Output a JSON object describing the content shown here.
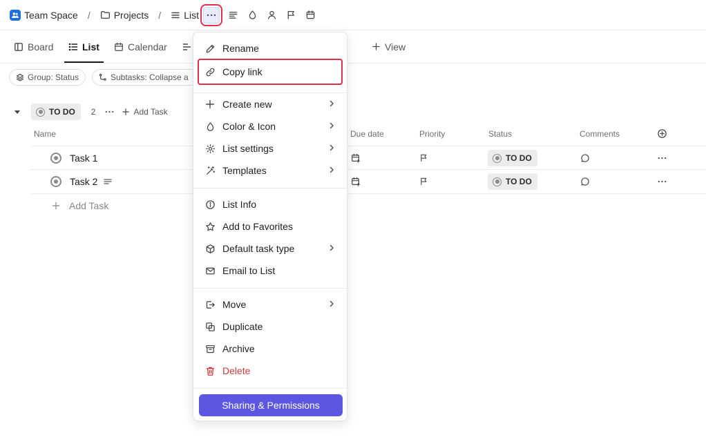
{
  "breadcrumb": {
    "space": "Team Space",
    "folder": "Projects",
    "list": "List",
    "separator": "/"
  },
  "tabs": [
    {
      "label": "Board",
      "icon": "board-icon"
    },
    {
      "label": "List",
      "icon": "list-icon",
      "active": true
    },
    {
      "label": "Calendar",
      "icon": "calendar-icon"
    },
    {
      "label": "",
      "icon": "gantt-icon"
    }
  ],
  "add_view_label": "View",
  "chips": {
    "group": "Group: Status",
    "subtasks": "Subtasks: Collapse a"
  },
  "group": {
    "status": "TO DO",
    "count": "2",
    "add_task": "Add Task"
  },
  "columns": {
    "name": "Name",
    "due_date": "Due date",
    "priority": "Priority",
    "status": "Status",
    "comments": "Comments"
  },
  "tasks": [
    {
      "name": "Task 1",
      "status": "TO DO",
      "has_description": false
    },
    {
      "name": "Task 2",
      "status": "TO DO",
      "has_description": true
    }
  ],
  "add_task_row": "Add Task",
  "menu": {
    "items": [
      {
        "label": "Rename",
        "icon": "pencil-icon"
      },
      {
        "label": "Copy link",
        "icon": "link-icon",
        "highlighted": true
      },
      {
        "label": "Create new",
        "icon": "plus-icon",
        "submenu": true
      },
      {
        "label": "Color & Icon",
        "icon": "droplet-icon",
        "submenu": true
      },
      {
        "label": "List settings",
        "icon": "gear-icon",
        "submenu": true
      },
      {
        "label": "Templates",
        "icon": "magic-wand-icon",
        "submenu": true
      },
      {
        "label": "List Info",
        "icon": "info-icon"
      },
      {
        "label": "Add to Favorites",
        "icon": "star-icon"
      },
      {
        "label": "Default task type",
        "icon": "cube-icon",
        "submenu": true
      },
      {
        "label": "Email to List",
        "icon": "mail-icon"
      },
      {
        "label": "Move",
        "icon": "move-icon",
        "submenu": true
      },
      {
        "label": "Duplicate",
        "icon": "duplicate-icon"
      },
      {
        "label": "Archive",
        "icon": "archive-icon"
      },
      {
        "label": "Delete",
        "icon": "trash-icon",
        "danger": true
      }
    ],
    "sharing_button": "Sharing & Permissions"
  },
  "colors": {
    "accent": "#5b57e0",
    "highlight_outline": "#e2304a",
    "danger": "#d13a3a",
    "space_avatar": "#1e6fd9"
  }
}
